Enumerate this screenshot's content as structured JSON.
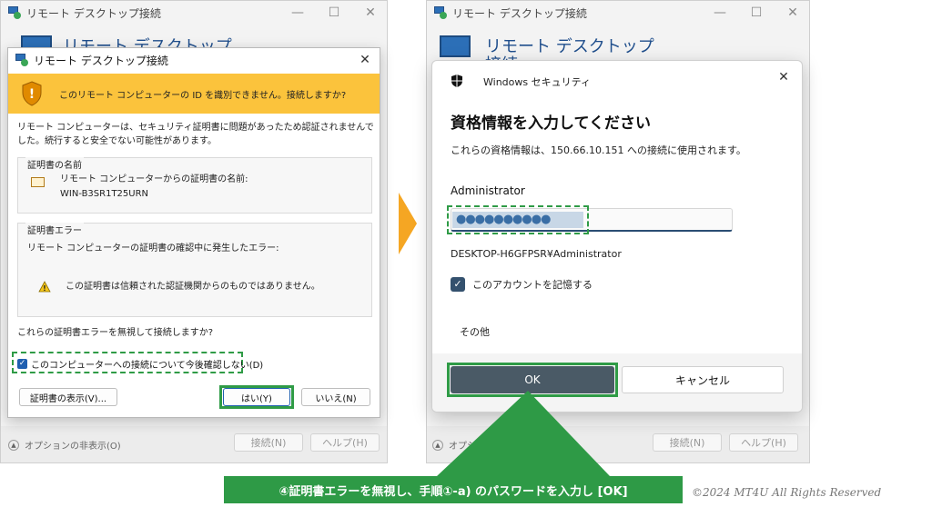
{
  "left_window": {
    "title": "リモート デスクトップ接続",
    "banner": "リモート デスクトップ",
    "options_toggle": "オプションの非表示(O)",
    "connect_button": "接続(N)",
    "help_button": "ヘルプ(H)"
  },
  "cert_dialog": {
    "title": "リモート デスクトップ接続",
    "warning": "このリモート コンピューターの ID を識別できません。接続しますか?",
    "description": "リモート コンピューターは、セキュリティ証明書に問題があったため認証されませんでした。続行すると安全でない可能性があります。",
    "cert_name_group": "証明書の名前",
    "cert_name_label": "リモート コンピューターからの証明書の名前:",
    "cert_name_value": "WIN-B3SR1T25URN",
    "cert_error_group": "証明書エラー",
    "cert_error_label": "リモート コンピューターの証明書の確認中に発生したエラー:",
    "cert_error_item": "この証明書は信頼された認証機関からのものではありません。",
    "question": "これらの証明書エラーを無視して接続しますか?",
    "dont_ask_checkbox": "このコンピューターへの接続について今後確認しない(D)",
    "dont_ask_checked": true,
    "view_cert_button": "証明書の表示(V)...",
    "yes_button": "はい(Y)",
    "no_button": "いいえ(N)"
  },
  "right_window": {
    "title": "リモート デスクトップ接続",
    "banner_line1": "リモート デスクトップ",
    "banner_line2": "接続",
    "options_toggle": "オプションの非表示(O)",
    "connect_button": "接続(N)",
    "help_button": "ヘルプ(H)"
  },
  "security_dialog": {
    "app_name": "Windows セキュリティ",
    "heading": "資格情報を入力してください",
    "subtext": "これらの資格情報は、150.66.10.151 への接続に使用されます。",
    "username": "Administrator",
    "password_mask": "●●●●●●●●●●",
    "domain_user": "DESKTOP-H6GFPSR¥Administrator",
    "remember_checkbox": "このアカウントを記憶する",
    "remember_checked": true,
    "more_choices": "その他",
    "ok_button": "OK",
    "cancel_button": "キャンセル"
  },
  "annotation": {
    "caption": "④証明書エラーを無視し、手順①-a) のパスワードを入力し [OK]",
    "copyright": "©2024 MT4U All Rights Reserved"
  },
  "colors": {
    "warning_bar": "#fbc33c",
    "highlight_green": "#2f9b46",
    "arrow_orange": "#f5a623",
    "ok_button": "#4a5a66"
  }
}
